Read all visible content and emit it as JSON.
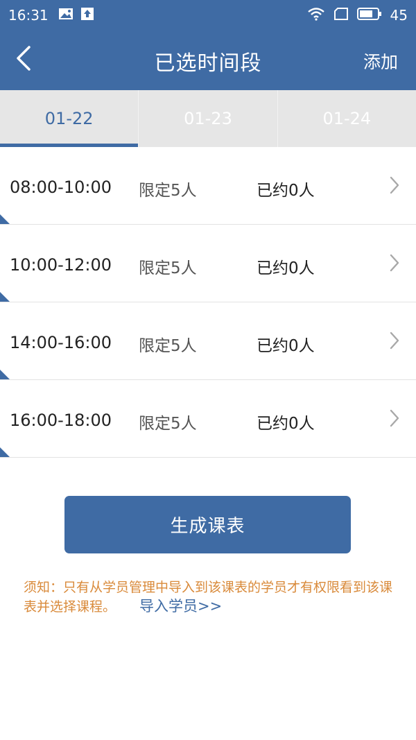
{
  "status_bar": {
    "time": "16:31",
    "battery": "45",
    "icons": [
      "image-icon",
      "upload-icon",
      "wifi-icon",
      "sim-icon",
      "battery-icon"
    ]
  },
  "nav": {
    "title": "已选时间段",
    "add_label": "添加",
    "back_icon": "chevron-left-icon"
  },
  "tabs": [
    {
      "label": "01-22",
      "active": true
    },
    {
      "label": "01-23",
      "active": false
    },
    {
      "label": "01-24",
      "active": false
    }
  ],
  "slots": [
    {
      "time": "08:00-10:00",
      "limit": "限定5人",
      "booked": "已约0人"
    },
    {
      "time": "10:00-12:00",
      "limit": "限定5人",
      "booked": "已约0人"
    },
    {
      "time": "14:00-16:00",
      "limit": "限定5人",
      "booked": "已约0人"
    },
    {
      "time": "16:00-18:00",
      "limit": "限定5人",
      "booked": "已约0人"
    }
  ],
  "generate_button": "生成课表",
  "notice": {
    "text": "须知：只有从学员管理中导入到该课表的学员才有权限看到该课表并选择课程。",
    "import_link": "导入学员>>"
  },
  "colors": {
    "primary": "#3f6ba4",
    "notice": "#d98a3a",
    "tab_bg": "#e6e6e6"
  }
}
